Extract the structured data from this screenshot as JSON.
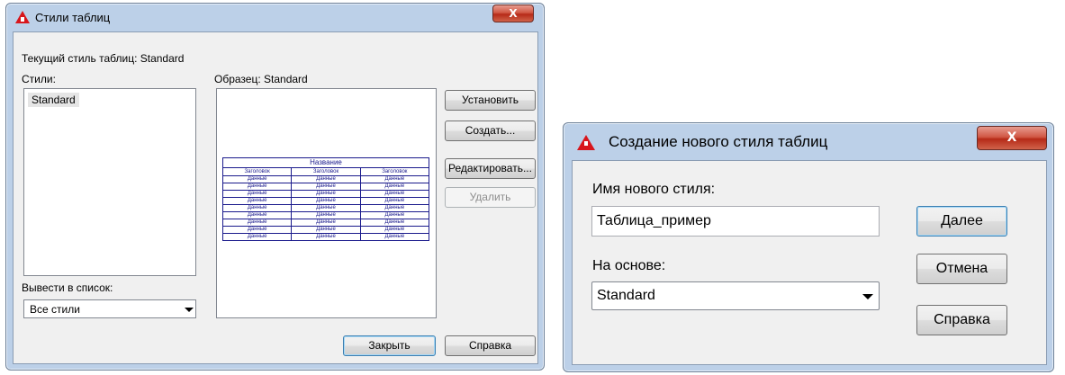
{
  "dialog_styles": {
    "title": "Стили таблиц",
    "close_label": "X",
    "current_style_text": "Текущий стиль таблиц: Standard",
    "styles_label": "Стили:",
    "styles_list": [
      "Standard"
    ],
    "preview_label": "Образец: Standard",
    "list_filter_label": "Вывести в список:",
    "list_filter_value": "Все стили",
    "buttons": {
      "set_current": "Установить",
      "create": "Создать...",
      "modify": "Редактировать...",
      "delete": "Удалить",
      "close": "Закрыть",
      "help": "Справка"
    },
    "preview_table": {
      "title": "Название",
      "header": "Заголовок",
      "data": "Данные",
      "columns": 3,
      "data_rows": 9
    }
  },
  "dialog_new_style": {
    "title": "Создание нового стиля таблиц",
    "close_label": "X",
    "name_label": "Имя нового стиля:",
    "name_value": "Таблица_пример",
    "based_on_label": "На основе:",
    "based_on_value": "Standard",
    "buttons": {
      "continue": "Далее",
      "cancel": "Отмена",
      "help": "Справка"
    }
  },
  "colors": {
    "logo_red": "#d8161c",
    "preview_blue": "#1a1a8c",
    "frame_blue": "#bcd0e8"
  }
}
